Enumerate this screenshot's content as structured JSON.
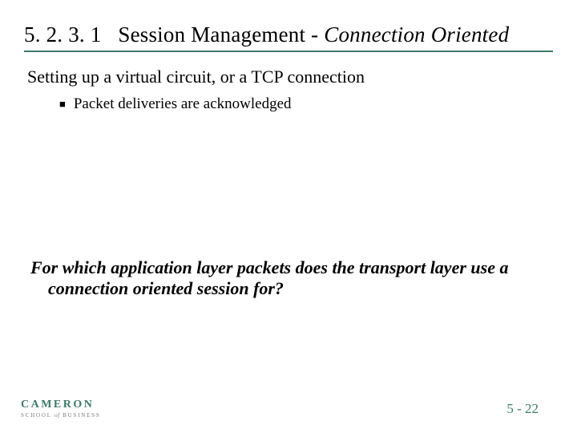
{
  "header": {
    "section_number": "5. 2. 3. 1",
    "title_plain": "Session Management - ",
    "title_italic": "Connection Oriented"
  },
  "content": {
    "lead": "Setting up a virtual circuit, or a TCP connection",
    "bullets": [
      {
        "text": "Packet deliveries are acknowledged"
      }
    ],
    "question": "For which application layer packets does the transport layer use a connection oriented session for?"
  },
  "footer": {
    "page": "5 - 22"
  },
  "logo": {
    "main": "CAMERON",
    "sub_pre": "SCHOOL ",
    "sub_of": "of",
    "sub_post": " BUSINESS"
  }
}
